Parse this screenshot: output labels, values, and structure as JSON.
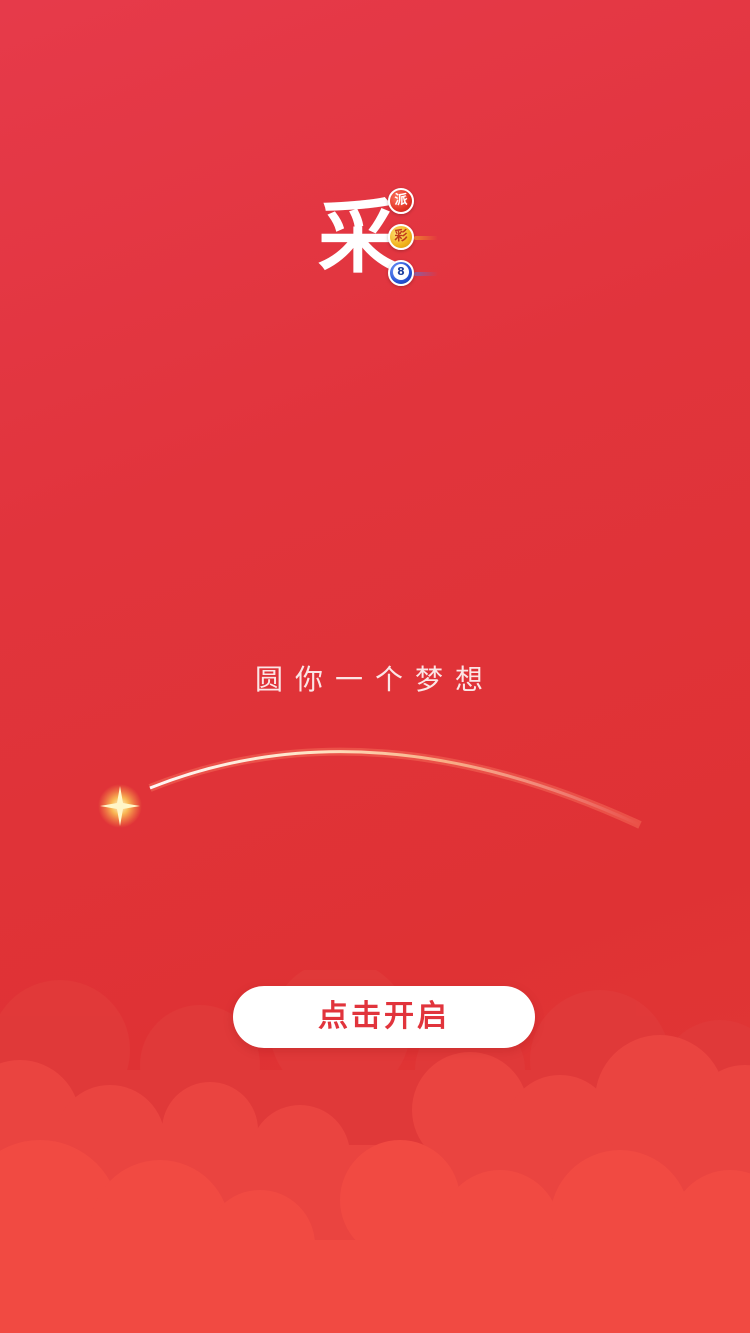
{
  "logo": {
    "main_char": "采",
    "balls": [
      "派",
      "彩",
      "8"
    ]
  },
  "slogan": "圆你一个梦想",
  "start_button": {
    "label": "点击开启"
  },
  "colors": {
    "background": "#e1343c",
    "button_text": "#e1343c",
    "button_bg": "#ffffff",
    "cloud_light": "#ef4a43",
    "cloud_dark": "#d72e2e"
  }
}
